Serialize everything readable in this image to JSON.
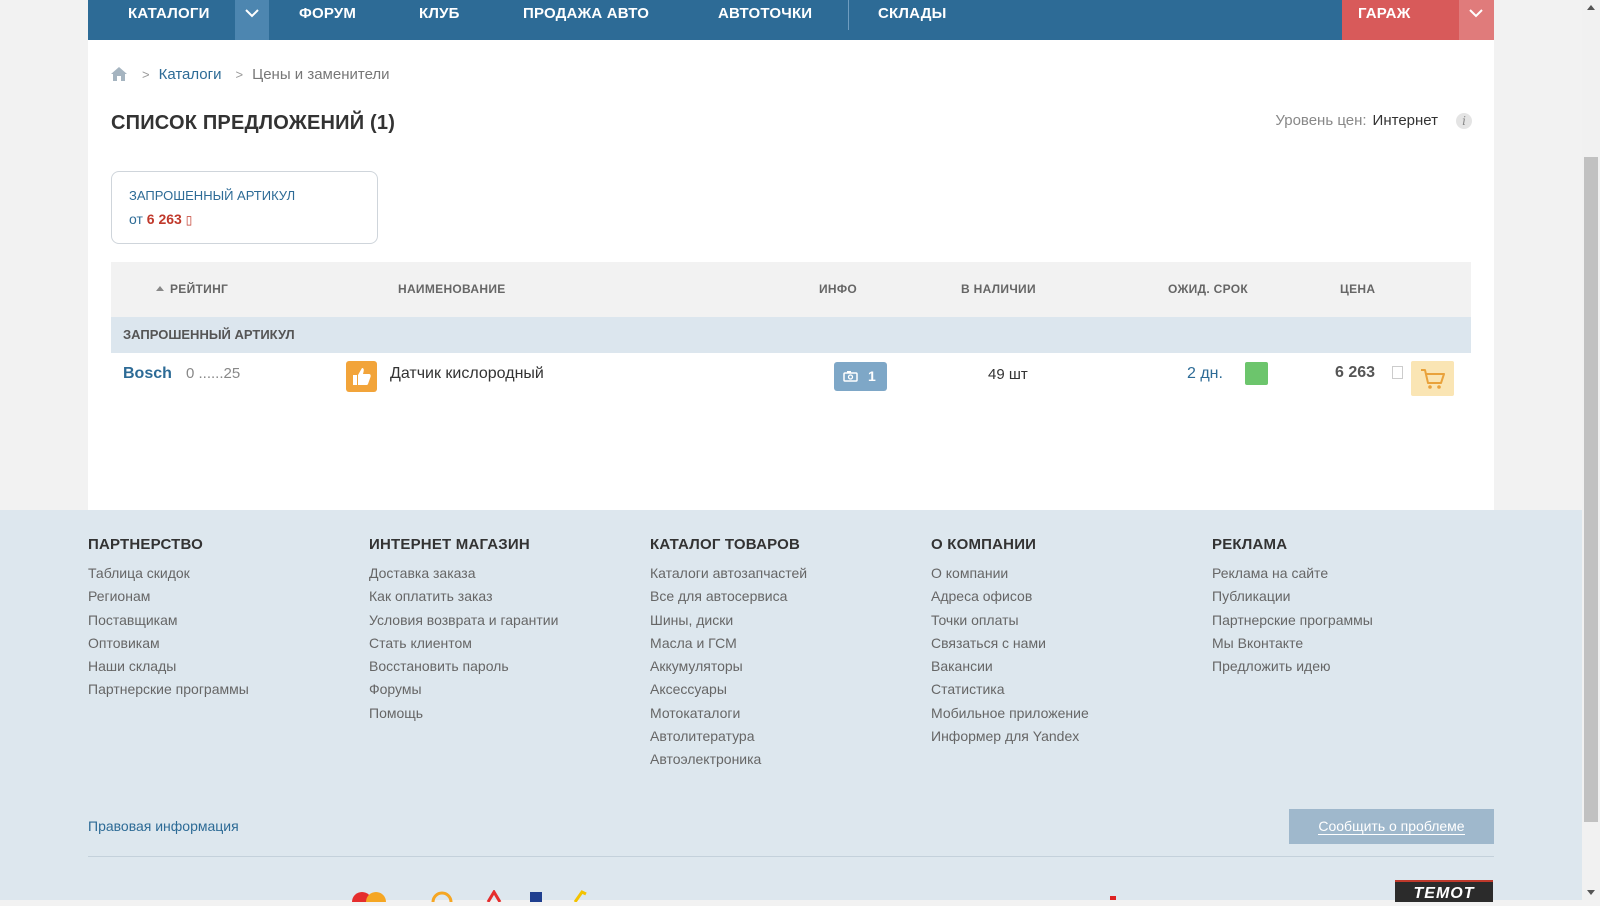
{
  "nav": {
    "items": [
      "КАТАЛОГИ",
      "ФОРУМ",
      "КЛУБ",
      "ПРОДАЖА АВТО",
      "АВТОТОЧКИ",
      "СКЛАДЫ"
    ],
    "garage": "ГАРАЖ",
    "colors": {
      "bar": "#2d6b96",
      "garage": "#d85a5a"
    }
  },
  "breadcrumb": {
    "links": [
      "Каталоги"
    ],
    "current": "Цены и заменители"
  },
  "page_title": "СПИСОК ПРЕДЛОЖЕНИЙ (1)",
  "price_level": {
    "label": "Уровень цен:",
    "value": "Интернет",
    "info_glyph": "i"
  },
  "requested": {
    "title": "ЗАПРОШЕННЫЙ АРТИКУЛ",
    "price_prefix": "от",
    "price": "6 263",
    "currency_glyph": "▯"
  },
  "table": {
    "headers": {
      "rating": "РЕЙТИНГ",
      "name": "НАИМЕНОВАНИЕ",
      "info": "ИНФО",
      "stock": "В НАЛИЧИИ",
      "term": "ОЖИД. СРОК",
      "price": "ЦЕНА"
    },
    "group": "ЗАПРОШЕННЫЙ АРТИКУЛ",
    "rows": [
      {
        "brand": "Bosch",
        "article": "0 ......25",
        "name": "Датчик кислородный",
        "info_count": "1",
        "stock": "49 шт",
        "term": "2 дн.",
        "price": "6 263",
        "term_color": "#6cc56c"
      }
    ]
  },
  "footer": {
    "columns": [
      {
        "title": "ПАРТНЕРСТВО",
        "links": [
          "Таблица скидок",
          "Регионам",
          "Поставщикам",
          "Оптовикам",
          "Наши склады",
          "Партнерские программы"
        ]
      },
      {
        "title": "ИНТЕРНЕТ МАГАЗИН",
        "links": [
          "Доставка заказа",
          "Как оплатить заказ",
          "Условия возврата и гарантии",
          "Стать клиентом",
          "Восстановить пароль",
          "Форумы",
          "Помощь"
        ]
      },
      {
        "title": "КАТАЛОГ ТОВАРОВ",
        "links": [
          "Каталоги автозапчастей",
          "Все для автосервиса",
          "Шины, диски",
          "Масла и ГСМ",
          "Аккумуляторы",
          "Аксессуары",
          "Мотокаталоги",
          "Автолитература",
          "Автоэлектроника"
        ]
      },
      {
        "title": "О КОМПАНИИ",
        "links": [
          "О компании",
          "Адреса офисов",
          "Точки оплаты",
          "Связаться с нами",
          "Вакансии",
          "Статистика",
          "Мобильное приложение",
          "Информер для Yandex"
        ]
      },
      {
        "title": "РЕКЛАМА",
        "links": [
          "Реклама на сайте",
          "Публикации",
          "Партнерские программы",
          "Мы Вконтакте",
          "Предложить идею"
        ]
      }
    ],
    "legal": "Правовая информация",
    "report": "Сообщить о проблеме",
    "temot": "TEMOT"
  }
}
